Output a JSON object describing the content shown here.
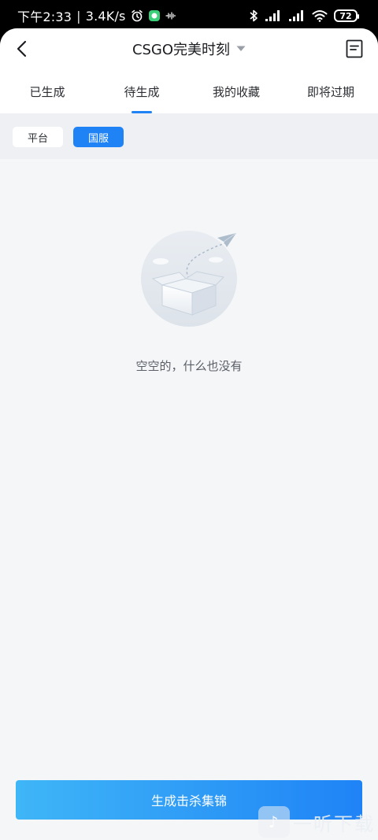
{
  "status_bar": {
    "time": "下午2:33",
    "network_speed": "3.4K/s",
    "battery_level": "72",
    "icons": [
      "alarm-icon",
      "notification-app-icon",
      "hd-voice-icon",
      "bluetooth-icon",
      "cellular-signal-icon",
      "wifi-icon",
      "battery-icon"
    ]
  },
  "header": {
    "title": "CSGO完美时刻",
    "back_icon": "chevron-left-icon",
    "title_dropdown_icon": "caret-down-icon",
    "menu_icon": "document-list-icon"
  },
  "tabs": [
    {
      "label": "已生成",
      "active": false
    },
    {
      "label": "待生成",
      "active": true
    },
    {
      "label": "我的收藏",
      "active": false
    },
    {
      "label": "即将过期",
      "active": false
    }
  ],
  "filters": {
    "platform_label": "平台",
    "national_label": "国服",
    "selected": "国服"
  },
  "empty_state": {
    "illustration": "empty-box-paper-plane",
    "message": "空空的，什么也没有"
  },
  "cta": {
    "label": "生成击杀集锦"
  },
  "watermark": {
    "text": "一听下载"
  },
  "colors": {
    "accent": "#1f83f6",
    "cta_gradient_start": "#3fb6f7",
    "background": "#f5f6f8"
  }
}
